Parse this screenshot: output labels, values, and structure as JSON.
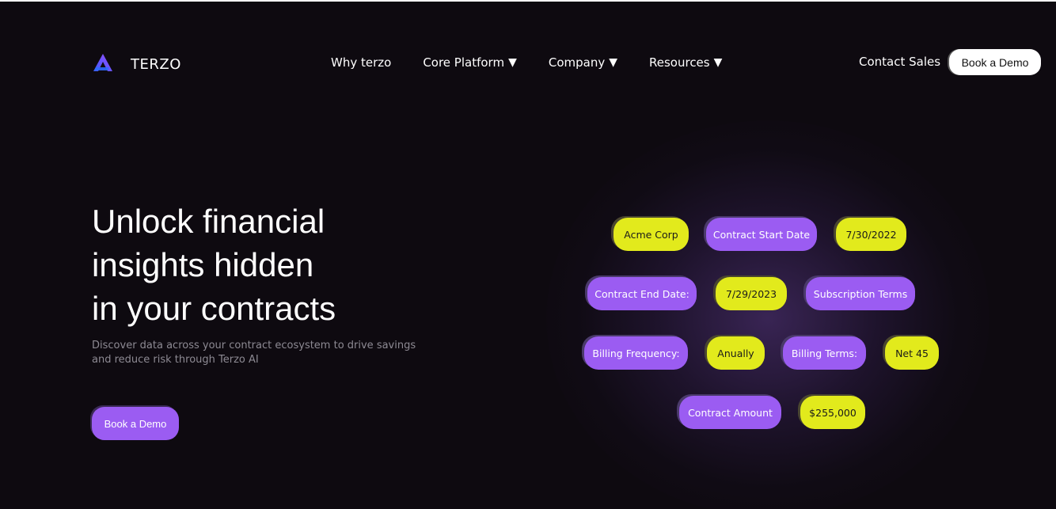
{
  "brand": {
    "name": "TERZO",
    "logo_icon": "terzo-logo-icon"
  },
  "nav": {
    "items": [
      {
        "label": "Why terzo",
        "has_dropdown": false
      },
      {
        "label": "Core Platform",
        "has_dropdown": true
      },
      {
        "label": "Company",
        "has_dropdown": true
      },
      {
        "label": "Resources",
        "has_dropdown": true
      }
    ],
    "caret": "▼",
    "contact_sales": "Contact Sales",
    "book_demo": "Book a Demo"
  },
  "hero": {
    "title_lines": [
      "Unlock financial",
      "insights hidden",
      "in your contracts"
    ],
    "subtitle": "Discover data across your contract ecosystem to drive savings and reduce risk through Terzo AI",
    "cta": "Book a Demo"
  },
  "tags": [
    {
      "label": "Acme Corp",
      "color": "yellow"
    },
    {
      "label": "Contract Start Date",
      "color": "purple"
    },
    {
      "label": "7/30/2022",
      "color": "yellow"
    },
    {
      "label": "Contract End Date:",
      "color": "purple"
    },
    {
      "label": "7/29/2023",
      "color": "yellow"
    },
    {
      "label": "Subscription Terms",
      "color": "purple"
    },
    {
      "label": "Billing Frequency:",
      "color": "purple"
    },
    {
      "label": "Anually",
      "color": "yellow"
    },
    {
      "label": "Billing Terms:",
      "color": "purple"
    },
    {
      "label": "Net 45",
      "color": "yellow"
    },
    {
      "label": "Contract Amount",
      "color": "purple"
    },
    {
      "label": "$255,000",
      "color": "yellow"
    }
  ],
  "colors": {
    "background": "#0e0a10",
    "accent_purple": "#9b5cf2",
    "accent_yellow": "#e2ea1c",
    "muted_text": "#8d8a93"
  }
}
